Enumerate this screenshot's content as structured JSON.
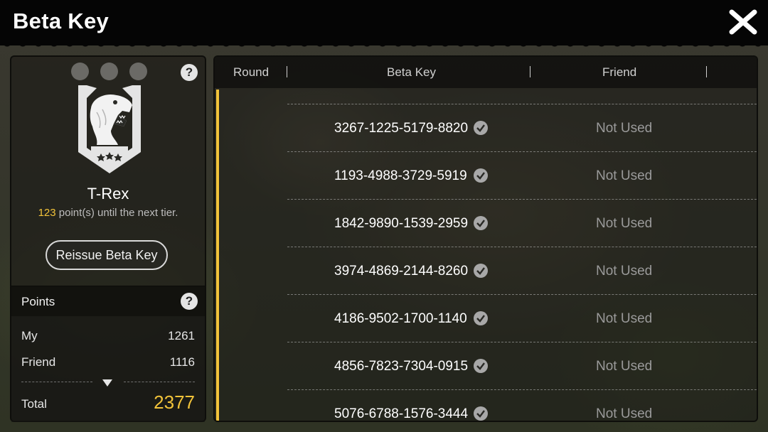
{
  "header": {
    "title": "Beta Key",
    "close_icon": "close-x-icon"
  },
  "tier": {
    "name": "T-Rex",
    "points_to_next": "123",
    "points_to_next_suffix": " point(s) until the next tier.",
    "badge_icon": "t-rex-shield-icon",
    "reissue_label": "Reissue Beta Key"
  },
  "points": {
    "title": "Points",
    "my_label": "My",
    "my_value": "1261",
    "friend_label": "Friend",
    "friend_value": "1116",
    "total_label": "Total",
    "total_value": "2377"
  },
  "table": {
    "columns": [
      "Round",
      "Beta Key",
      "Friend"
    ],
    "rows": [
      {
        "round": "",
        "key": "3267-1225-5179-8820",
        "status": "Not Used"
      },
      {
        "round": "",
        "key": "1193-4988-3729-5919",
        "status": "Not Used"
      },
      {
        "round": "",
        "key": "1842-9890-1539-2959",
        "status": "Not Used"
      },
      {
        "round": "",
        "key": "3974-4869-2144-8260",
        "status": "Not Used"
      },
      {
        "round": "",
        "key": "4186-9502-1700-1140",
        "status": "Not Used"
      },
      {
        "round": "",
        "key": "4856-7823-7304-0915",
        "status": "Not Used"
      },
      {
        "round": "",
        "key": "5076-6788-1576-3444",
        "status": "Not Used"
      }
    ]
  },
  "colors": {
    "accent_gold": "#f2c33a",
    "status_gray": "#9a9a9a"
  }
}
